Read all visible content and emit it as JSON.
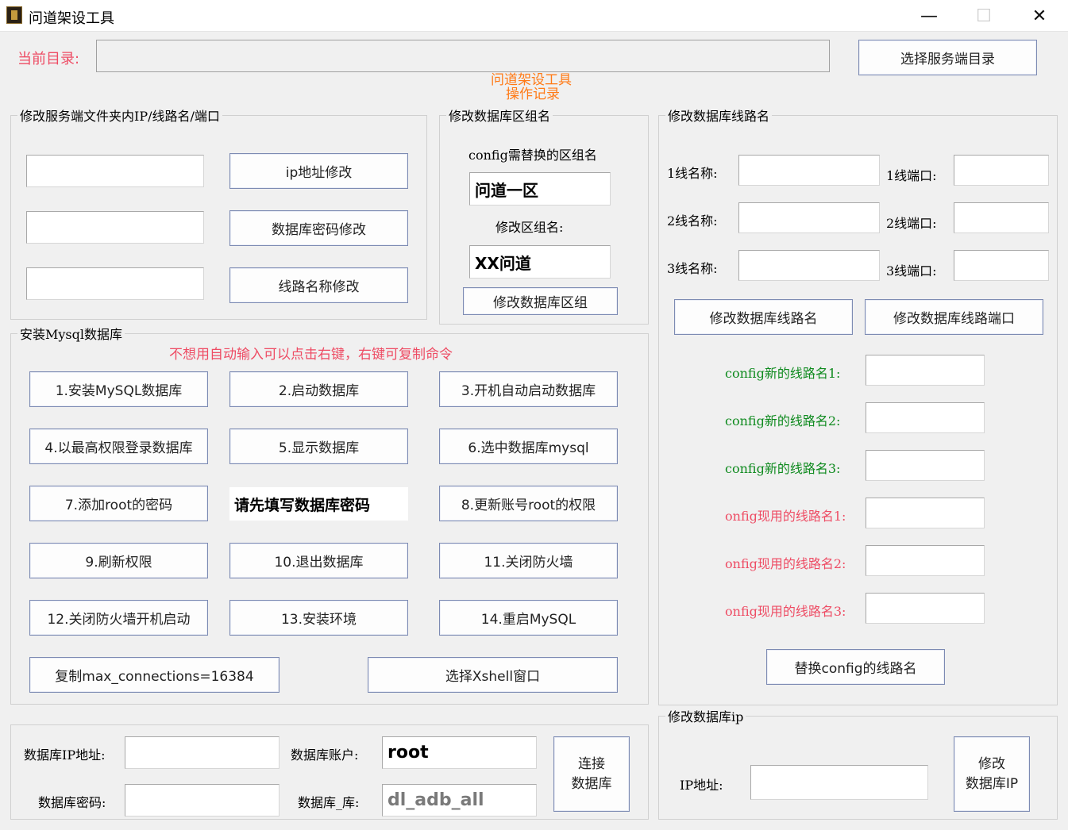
{
  "window": {
    "title": "问道架设工具",
    "minimize": "—",
    "maximize": "☐",
    "close": "✕"
  },
  "top": {
    "current_dir_label": "当前目录:",
    "current_dir_value": "",
    "choose_dir_button": "选择服务端目录"
  },
  "log": {
    "line1": "问道架设工具",
    "line2": "操作记录"
  },
  "server_group": {
    "title": "修改服务端文件夹内IP/线路名/端口",
    "fields": [
      "",
      "",
      ""
    ],
    "buttons": [
      "ip地址修改",
      "数据库密码修改",
      "线路名称修改"
    ]
  },
  "zone_group": {
    "title": "修改数据库区组名",
    "config_label": "config需替换的区组名",
    "config_value": "问道一区",
    "new_label": "修改区组名:",
    "new_value": "XX问道",
    "button": "修改数据库区组"
  },
  "line_group": {
    "title": "修改数据库线路名",
    "lines": [
      {
        "name_label": "1线名称:",
        "name_value": "",
        "port_label": "1线端口:",
        "port_value": ""
      },
      {
        "name_label": "2线名称:",
        "name_value": "",
        "port_label": "2线端口:",
        "port_value": ""
      },
      {
        "name_label": "3线名称:",
        "name_value": "",
        "port_label": "3线端口:",
        "port_value": ""
      }
    ],
    "name_button": "修改数据库线路名",
    "port_button": "修改数据库线路端口",
    "config_new": [
      "config新的线路名1:",
      "config新的线路名2:",
      "config新的线路名3:"
    ],
    "config_current": [
      "onfig现用的线路名1:",
      "onfig现用的线路名2:",
      "onfig现用的线路名3:"
    ],
    "replace_button": "替换config的线路名"
  },
  "mysql_group": {
    "title": "安装Mysql数据库",
    "hint": "不想用自动输入可以点击右键，右键可复制命令",
    "buttons": [
      "1.安装MySQL数据库",
      "2.启动数据库",
      "3.开机自动启动数据库",
      "4.以最高权限登录数据库",
      "5.显示数据库",
      "6.选中数据库mysql",
      "7.添加root的密码",
      "8.更新账号root的权限",
      "9.刷新权限",
      "10.退出数据库",
      "11.关闭防火墙",
      "12.关闭防火墙开机启动",
      "13.安装环境",
      "14.重启MySQL",
      "复制max_connections=16384",
      "选择Xshell窗口"
    ],
    "password_placeholder": "请先填写数据库密码"
  },
  "db_conn": {
    "ip_label": "数据库IP地址:",
    "ip_value": "",
    "account_label": "数据库账户:",
    "account_value": "root",
    "password_label": "数据库密码:",
    "password_value": "",
    "db_label": "数据库_库:",
    "db_value": "dl_adb_all",
    "connect_button_1": "连接",
    "connect_button_2": "数据库"
  },
  "db_ip_group": {
    "title": "修改数据库ip",
    "ip_label": "IP地址:",
    "ip_value": "",
    "button_1": "修改",
    "button_2": "数据库IP"
  }
}
